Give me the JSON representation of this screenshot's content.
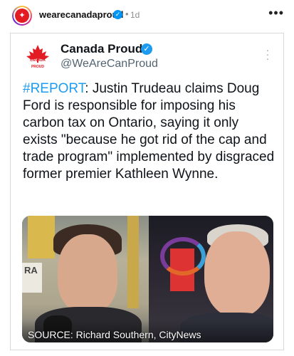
{
  "post": {
    "username": "wearecanadaproud",
    "separator": "•",
    "time": "1d",
    "more_label": "•••"
  },
  "tweet": {
    "logo_text": "CANADA PROUD",
    "name": "Canada Proud",
    "handle": "@WeAreCanProud",
    "hashtag": "#REPORT",
    "body": ": Justin Trudeau claims Doug Ford is responsible for imposing his carbon tax on Ontario, saying it only exists \"because he got rid of the cap and trade program\" implemented by disgraced former premier Kathleen Wynne.",
    "photo_sign": "RA",
    "photo_credit": "SOURCE: Richard Southern, CityNews"
  },
  "icons": {
    "verified": "check-badge-icon",
    "maple": "maple-leaf-icon",
    "more": "more-horizontal-icon"
  },
  "colors": {
    "brand_red": "#e31b23",
    "link_blue": "#1d9bf0",
    "verified_blue": "#0095f6"
  }
}
